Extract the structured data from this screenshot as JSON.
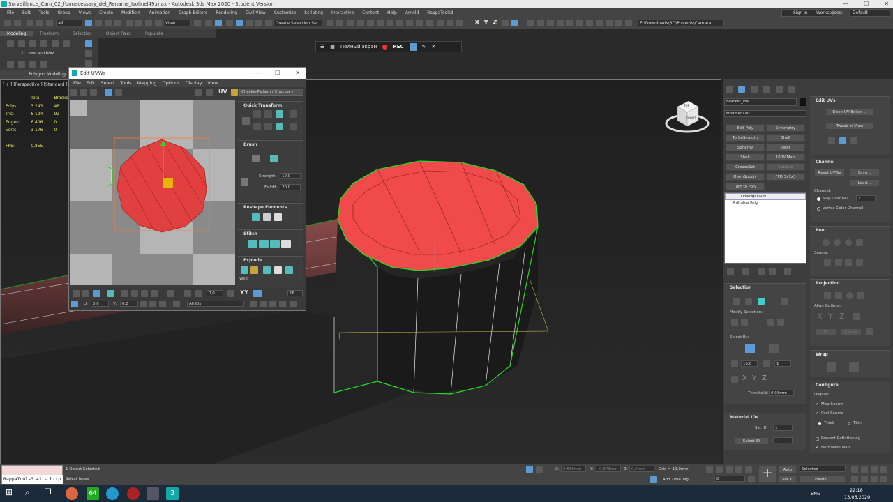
{
  "titlebar": {
    "title": "Surveillance_Cam_02_(Unnecessary_del_Rename_Isolinel49.max - Autodesk 3ds Max 2020 - Student Version"
  },
  "menu": [
    "File",
    "Edit",
    "Tools",
    "Group",
    "Views",
    "Create",
    "Modifiers",
    "Animation",
    "Graph Editors",
    "Rendering",
    "Civil View",
    "Customize",
    "Scripting",
    "Interactive",
    "Content",
    "Help",
    "Arnold",
    "RappaTools3"
  ],
  "signin": "Sign In",
  "workspace": {
    "label": "Workspaces:",
    "value": "Default"
  },
  "toolbar": {
    "filter": "All",
    "view": "View",
    "selection_set": "Create Selection Set",
    "axis_x": "X",
    "axis_y": "Y",
    "axis_z": "Z",
    "path": "E:\\Downloads\\3D\\Projects\\Camera"
  },
  "ribbon": {
    "tabs": [
      "Modeling",
      "Freeform",
      "Selection",
      "Object Paint",
      "Populate"
    ],
    "sub_label": "Polygon Modeling"
  },
  "modifier_left": "1: Unwrap UVW",
  "viewport": {
    "label": "[ + ] [Perspective ] [Standard ] [E",
    "stats": {
      "header_total": "Total",
      "header_obj": "Bracket_",
      "rows": [
        {
          "k": "Polys:",
          "total": "3 243",
          "obj": "46"
        },
        {
          "k": "Tris:",
          "total": "6 124",
          "obj": "92"
        },
        {
          "k": "Edges:",
          "total": "6 406",
          "obj": "0"
        },
        {
          "k": "Verts:",
          "total": "3 176",
          "obj": "0"
        }
      ],
      "fps_label": "FPS:",
      "fps": "0,855"
    },
    "viewcube_top": "TOP",
    "viewcube_front": "FRONT"
  },
  "recbar": {
    "fullscreen": "Полный экран",
    "rec": "REC"
  },
  "uvw": {
    "title": "Edit UVWs",
    "menu": [
      "File",
      "Edit",
      "Select",
      "Tools",
      "Mapping",
      "Options",
      "Display",
      "View"
    ],
    "uv": "UV",
    "checker": "CheckerPattern  ( Checker )",
    "sections": {
      "quick": "Quick Transform",
      "brush": "Brush",
      "strength_label": "Strength:",
      "strength": "10,0",
      "falloff_label": "Falloff:",
      "falloff": "20,0",
      "reshape": "Reshape Elements",
      "stitch": "Stitch",
      "explode": "Explode",
      "weld": "Weld"
    },
    "bottom": {
      "u_label": "U:",
      "u": "0,0",
      "v_label": "V:",
      "v": "0,0",
      "spin": "0,0",
      "xy": "XY",
      "count": "16",
      "ids": "All IDs"
    }
  },
  "cmd": {
    "object_name": "Bracket_low",
    "modifier_list": "Modifier List",
    "modbuttons": [
      "Edit Poly",
      "Symmetry",
      "TurboSmooth",
      "Shell",
      "Spherify",
      "Twist",
      "Shell",
      "UVW Map",
      "CreaseSet",
      "Surface",
      "OpenSubdiv",
      "FFD 3x3x3",
      "Turn to Poly"
    ],
    "stack": [
      "Unwrap UVW",
      "Editable Poly"
    ],
    "edit_uvs": {
      "title": "Edit UVs",
      "open": "Open UV Editor ...",
      "tweak": "Tweak In View"
    },
    "channel": {
      "title": "Channel",
      "reset": "Reset UVWs",
      "save": "Save...",
      "load": "Load...",
      "channel_label": "Channel:",
      "map_channel": "Map Channel:",
      "map_value": "1",
      "vertex_color": "Vertex Color Channel"
    },
    "peel": {
      "title": "Peel",
      "seams": "Seams:"
    },
    "projection": {
      "title": "Projection",
      "align": "Align Options:",
      "x": "X",
      "y": "Y",
      "z": "Z",
      "fit": "Fit",
      "center": "Center"
    },
    "wrap": {
      "title": "Wrap"
    },
    "configure": {
      "title": "Configure",
      "display": "Display:",
      "map_seams": "Map Seams",
      "peel_seams": "Peel Seams",
      "thick": "Thick",
      "thin": "Thin",
      "prevent": "Prevent Reflattening",
      "normalize": "Normalize Map"
    },
    "selection": {
      "title": "Selection",
      "modify": "Modify Selection:",
      "select_by": "Select By:",
      "angle": "15,0",
      "num": "1",
      "x": "X",
      "y": "Y",
      "z": "Z",
      "threshold_label": "Threshold:",
      "threshold": "0,03mm"
    },
    "material": {
      "title": "Material IDs",
      "set_id": "Set ID:",
      "set_val": "1",
      "select_id": "Select ID",
      "select_val": "1"
    }
  },
  "status": {
    "script": "RappaTools3.41 - http",
    "selected": "1 Object Selected",
    "hint": "Select faces",
    "x_label": "X:",
    "x": "0,568mm",
    "y_label": "Y:",
    "y": "-0,373mm",
    "z_label": "Z:",
    "z": "0,0mm",
    "grid": "Grid = 10,0mm",
    "add_time_tag": "Add Time Tag",
    "frame": "0",
    "auto": "Auto",
    "set_k": "Set K.",
    "selected_dd": "Selected",
    "filters": "Filters..."
  },
  "taskbar": {
    "lang": "ENG",
    "time": "22:18",
    "date": "13.06.2020",
    "badge": "64"
  },
  "colors": {
    "accent": "#5b9bd5",
    "selection": "#ff3b3b",
    "wire": "#22dd22"
  }
}
